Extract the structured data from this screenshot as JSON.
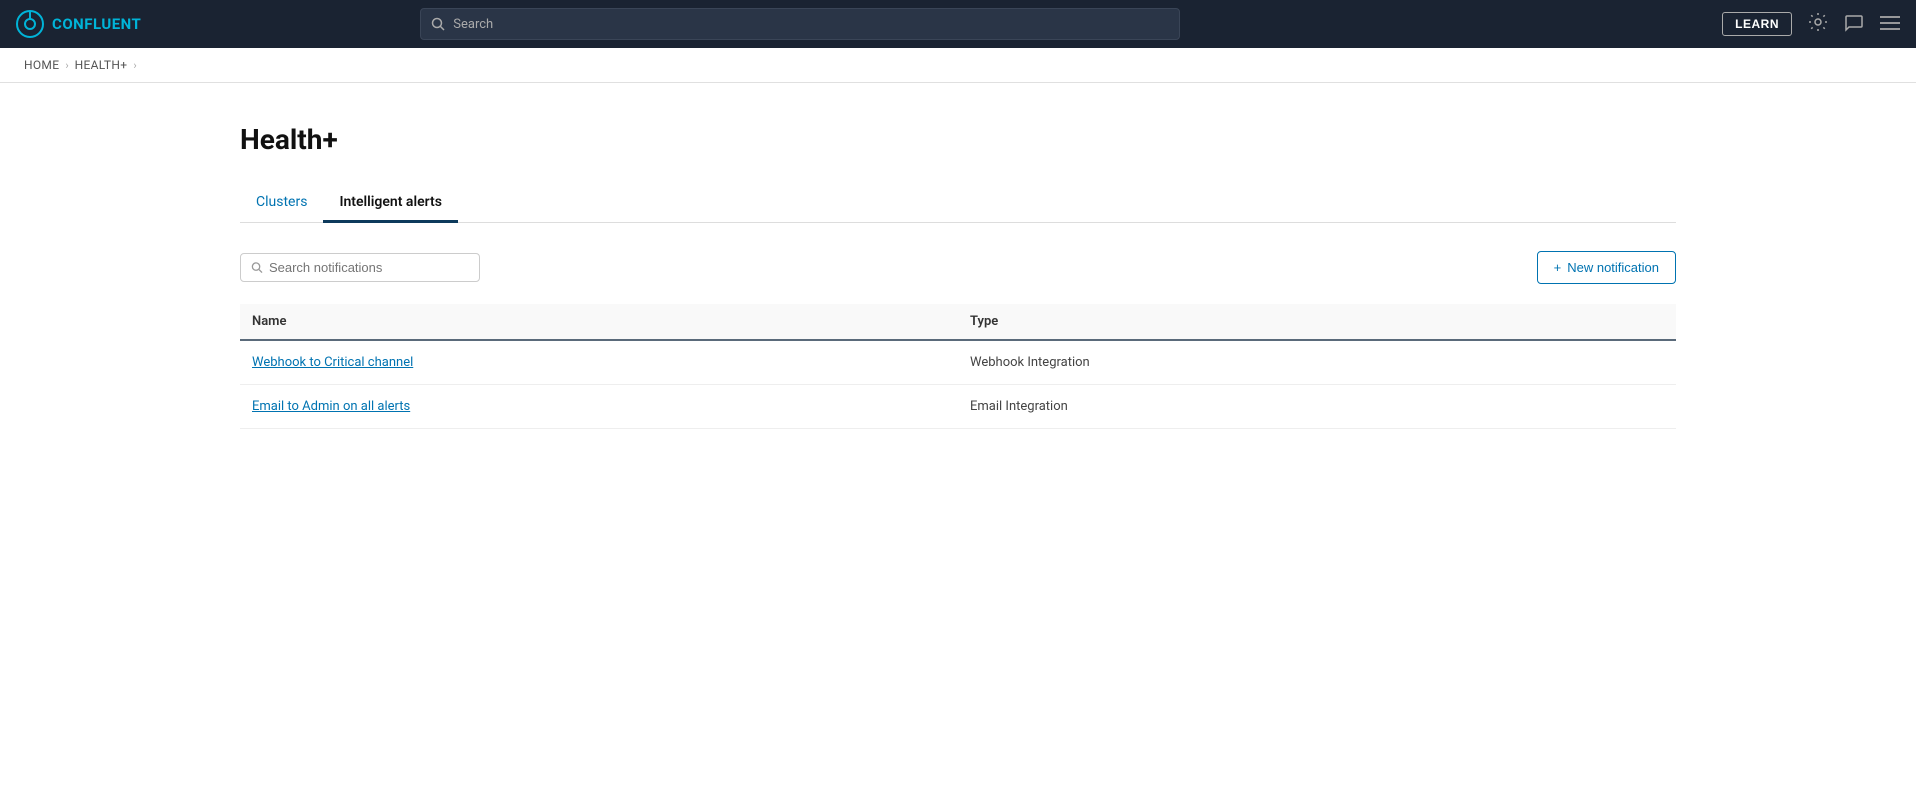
{
  "nav": {
    "logo_text": "CONFLUENT",
    "search_placeholder": "Search",
    "learn_label": "LEARN"
  },
  "breadcrumb": {
    "items": [
      {
        "label": "HOME",
        "link": true
      },
      {
        "label": "HEALTH+",
        "link": true
      }
    ]
  },
  "page": {
    "title": "Health+",
    "tabs": [
      {
        "id": "clusters",
        "label": "Clusters",
        "active": false
      },
      {
        "id": "intelligent-alerts",
        "label": "Intelligent alerts",
        "active": true
      }
    ]
  },
  "toolbar": {
    "search_placeholder": "Search notifications",
    "new_notification_label": "New notification"
  },
  "table": {
    "columns": [
      {
        "id": "name",
        "label": "Name"
      },
      {
        "id": "type",
        "label": "Type"
      }
    ],
    "rows": [
      {
        "name": "Webhook to Critical channel",
        "type": "Webhook Integration"
      },
      {
        "name": "Email to Admin on all alerts",
        "type": "Email Integration"
      }
    ]
  },
  "colors": {
    "accent": "#0073b1",
    "nav_bg": "#1a2332",
    "active_tab_underline": "#0d3a5c"
  }
}
